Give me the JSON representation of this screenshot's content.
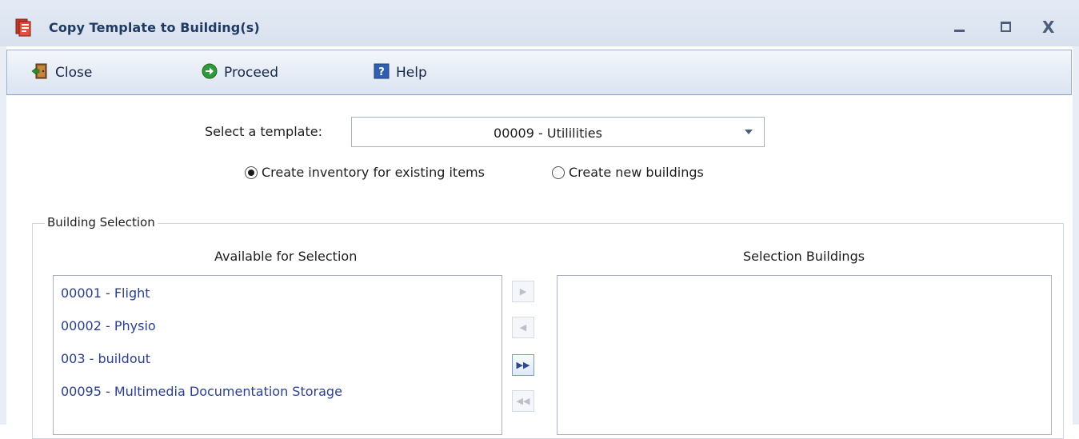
{
  "window": {
    "title": "Copy Template to Building(s)",
    "controls": {
      "close_glyph": "X"
    }
  },
  "toolbar": {
    "close_label": "Close",
    "proceed_label": "Proceed",
    "help_label": "Help"
  },
  "template": {
    "label": "Select a template:",
    "value": "00009 - Utililities"
  },
  "options": {
    "existing_label": "Create inventory for existing items",
    "new_label": "Create new buildings",
    "selected": "existing"
  },
  "building_selection": {
    "legend": "Building Selection",
    "available_header": "Available for Selection",
    "selected_header": "Selection Buildings",
    "available_items": [
      "00001 - Flight",
      "00002 - Physio",
      "003 - buildout",
      "00095 - Multimedia Documentation Storage"
    ],
    "selected_items": []
  },
  "move_buttons": {
    "right_glyph": "▶",
    "left_glyph": "◀",
    "all_right_glyph": "▶▶",
    "all_left_glyph": "◀◀"
  },
  "colors": {
    "title_text": "#1f3a63",
    "list_item_text": "#2a3f8f",
    "toolbar_top": "#f3f6fb",
    "toolbar_bottom": "#dbe4f0"
  }
}
